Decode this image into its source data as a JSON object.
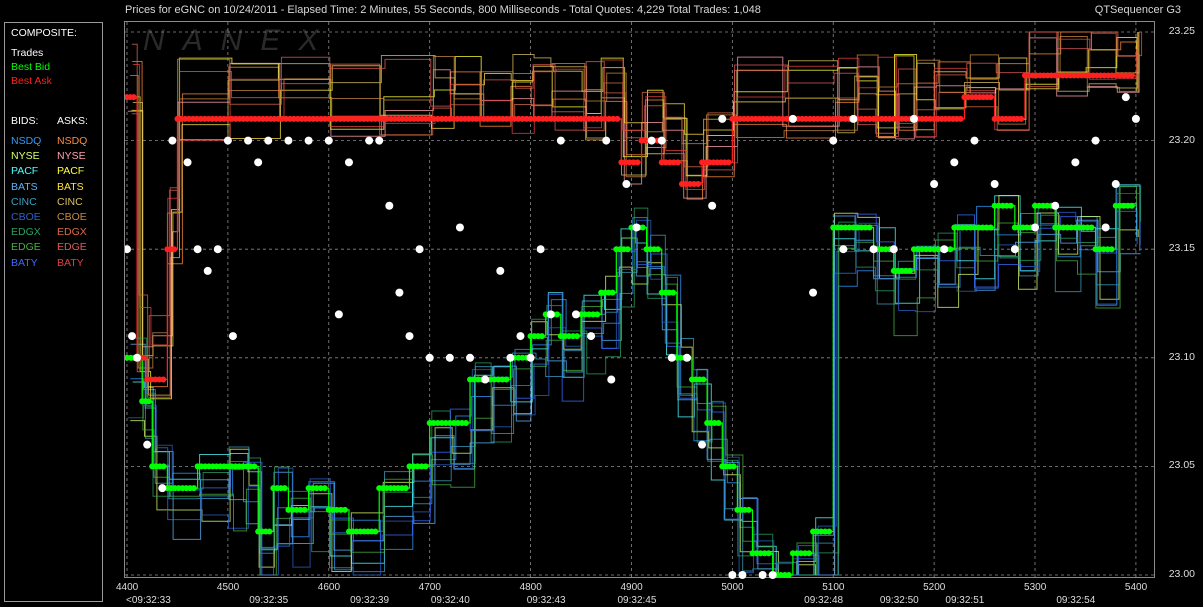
{
  "header": {
    "title": "Prices for  eGNC  on  10/24/2011  -  Elapsed Time: 2 Minutes, 55 Seconds, 800 Milliseconds  -  Total Quotes: 4,229  Total Trades: 1,048",
    "app_name": "QTSequencer G3",
    "watermark": "NANEX"
  },
  "legend": {
    "composite_label": "COMPOSITE:",
    "trades": "Trades",
    "best_bid": "Best Bid",
    "best_ask": "Best Ask",
    "bids_label": "BIDS:",
    "asks_label": "ASKS:",
    "exchanges": [
      {
        "bid": "NSDQ",
        "ask": "NSDQ",
        "bid_color": "#2f9bff",
        "ask_color": "#ff8a3a"
      },
      {
        "bid": "NYSE",
        "ask": "NYSE",
        "bid_color": "#d8ff6a",
        "ask_color": "#ff9fb0"
      },
      {
        "bid": "PACF",
        "ask": "PACF",
        "bid_color": "#4dffff",
        "ask_color": "#ffff33"
      },
      {
        "bid": "BATS",
        "ask": "BATS",
        "bid_color": "#5ab4ff",
        "ask_color": "#ffe040"
      },
      {
        "bid": "CINC",
        "ask": "CINC",
        "bid_color": "#3aa0c0",
        "ask_color": "#d8c060"
      },
      {
        "bid": "CBOE",
        "ask": "CBOE",
        "bid_color": "#2a60c8",
        "ask_color": "#c88840"
      },
      {
        "bid": "EDGX",
        "ask": "EDGX",
        "bid_color": "#2aa060",
        "ask_color": "#d86a4a"
      },
      {
        "bid": "EDGE",
        "ask": "EDGE",
        "bid_color": "#4ab040",
        "ask_color": "#e05a5a"
      },
      {
        "bid": "BATY",
        "ask": "BATY",
        "bid_color": "#3a6aff",
        "ask_color": "#e04040"
      }
    ],
    "colors": {
      "trades": "#ffffff",
      "best_bid": "#00ff00",
      "best_ask": "#ff2020"
    }
  },
  "chart_data": {
    "type": "line",
    "y_ticks": [
      "23.25",
      "23.20",
      "23.15",
      "23.10",
      "23.05",
      "23.00"
    ],
    "ylim": [
      23.0,
      23.25
    ],
    "x_seq_ticks": [
      "4400",
      "4500",
      "4600",
      "4700",
      "4800",
      "4900",
      "5000",
      "5100",
      "5200",
      "5300",
      "5400"
    ],
    "x_time_ticks": [
      "<09:32:33",
      "09:32:35",
      "09:32:39",
      "09:32:40",
      "09:32:43",
      "09:32:45",
      "09:32:48",
      "09:32:50",
      "09:32:51",
      "09:32:54"
    ],
    "xlim": [
      4400,
      5410
    ],
    "best_bid": [
      [
        4400,
        23.1
      ],
      [
        4415,
        23.08
      ],
      [
        4425,
        23.05
      ],
      [
        4440,
        23.04
      ],
      [
        4470,
        23.05
      ],
      [
        4500,
        23.05
      ],
      [
        4515,
        23.05
      ],
      [
        4530,
        23.02
      ],
      [
        4545,
        23.04
      ],
      [
        4560,
        23.03
      ],
      [
        4580,
        23.04
      ],
      [
        4600,
        23.03
      ],
      [
        4620,
        23.02
      ],
      [
        4650,
        23.04
      ],
      [
        4680,
        23.05
      ],
      [
        4700,
        23.07
      ],
      [
        4720,
        23.07
      ],
      [
        4740,
        23.09
      ],
      [
        4760,
        23.09
      ],
      [
        4780,
        23.1
      ],
      [
        4800,
        23.11
      ],
      [
        4815,
        23.12
      ],
      [
        4830,
        23.11
      ],
      [
        4850,
        23.12
      ],
      [
        4870,
        23.13
      ],
      [
        4885,
        23.15
      ],
      [
        4900,
        23.16
      ],
      [
        4915,
        23.15
      ],
      [
        4930,
        23.13
      ],
      [
        4945,
        23.1
      ],
      [
        4960,
        23.09
      ],
      [
        4975,
        23.07
      ],
      [
        4990,
        23.05
      ],
      [
        5005,
        23.03
      ],
      [
        5020,
        23.01
      ],
      [
        5040,
        23.0
      ],
      [
        5060,
        23.01
      ],
      [
        5080,
        23.02
      ],
      [
        5100,
        23.16
      ],
      [
        5120,
        23.16
      ],
      [
        5140,
        23.15
      ],
      [
        5160,
        23.14
      ],
      [
        5180,
        23.15
      ],
      [
        5200,
        23.15
      ],
      [
        5220,
        23.16
      ],
      [
        5240,
        23.16
      ],
      [
        5260,
        23.17
      ],
      [
        5280,
        23.16
      ],
      [
        5300,
        23.17
      ],
      [
        5320,
        23.16
      ],
      [
        5340,
        23.16
      ],
      [
        5360,
        23.15
      ],
      [
        5380,
        23.17
      ],
      [
        5400,
        23.17
      ]
    ],
    "best_ask": [
      [
        4400,
        23.22
      ],
      [
        4410,
        23.1
      ],
      [
        4420,
        23.09
      ],
      [
        4440,
        23.15
      ],
      [
        4450,
        23.21
      ],
      [
        4500,
        23.21
      ],
      [
        4550,
        23.21
      ],
      [
        4600,
        23.21
      ],
      [
        4650,
        23.21
      ],
      [
        4700,
        23.21
      ],
      [
        4720,
        23.21
      ],
      [
        4750,
        23.21
      ],
      [
        4780,
        23.21
      ],
      [
        4800,
        23.21
      ],
      [
        4820,
        23.21
      ],
      [
        4850,
        23.21
      ],
      [
        4870,
        23.21
      ],
      [
        4890,
        23.19
      ],
      [
        4910,
        23.2
      ],
      [
        4930,
        23.19
      ],
      [
        4950,
        23.18
      ],
      [
        4970,
        23.19
      ],
      [
        5000,
        23.21
      ],
      [
        5050,
        23.21
      ],
      [
        5100,
        23.21
      ],
      [
        5120,
        23.21
      ],
      [
        5140,
        23.21
      ],
      [
        5160,
        23.21
      ],
      [
        5180,
        23.21
      ],
      [
        5200,
        23.21
      ],
      [
        5230,
        23.22
      ],
      [
        5260,
        23.21
      ],
      [
        5290,
        23.23
      ],
      [
        5320,
        23.23
      ],
      [
        5350,
        23.23
      ],
      [
        5380,
        23.23
      ],
      [
        5400,
        23.23
      ]
    ],
    "trades": [
      [
        4400,
        23.15
      ],
      [
        4405,
        23.11
      ],
      [
        4410,
        23.1
      ],
      [
        4420,
        23.06
      ],
      [
        4435,
        23.04
      ],
      [
        4445,
        23.2
      ],
      [
        4460,
        23.19
      ],
      [
        4470,
        23.15
      ],
      [
        4480,
        23.14
      ],
      [
        4490,
        23.15
      ],
      [
        4500,
        23.2
      ],
      [
        4505,
        23.11
      ],
      [
        4520,
        23.2
      ],
      [
        4530,
        23.19
      ],
      [
        4540,
        23.2
      ],
      [
        4560,
        23.2
      ],
      [
        4580,
        23.2
      ],
      [
        4600,
        23.2
      ],
      [
        4610,
        23.12
      ],
      [
        4620,
        23.19
      ],
      [
        4640,
        23.2
      ],
      [
        4650,
        23.2
      ],
      [
        4660,
        23.17
      ],
      [
        4670,
        23.13
      ],
      [
        4680,
        23.11
      ],
      [
        4690,
        23.15
      ],
      [
        4700,
        23.1
      ],
      [
        4720,
        23.1
      ],
      [
        4730,
        23.16
      ],
      [
        4740,
        23.1
      ],
      [
        4755,
        23.09
      ],
      [
        4770,
        23.14
      ],
      [
        4780,
        23.1
      ],
      [
        4790,
        23.11
      ],
      [
        4800,
        23.1
      ],
      [
        4810,
        23.15
      ],
      [
        4820,
        23.12
      ],
      [
        4830,
        23.2
      ],
      [
        4845,
        23.12
      ],
      [
        4860,
        23.11
      ],
      [
        4875,
        23.2
      ],
      [
        4880,
        23.09
      ],
      [
        4895,
        23.18
      ],
      [
        4905,
        23.16
      ],
      [
        4920,
        23.2
      ],
      [
        4930,
        23.2
      ],
      [
        4940,
        23.1
      ],
      [
        4955,
        23.1
      ],
      [
        4970,
        23.06
      ],
      [
        4980,
        23.17
      ],
      [
        4990,
        23.21
      ],
      [
        5000,
        23.0
      ],
      [
        5010,
        23.0
      ],
      [
        5030,
        23.0
      ],
      [
        5040,
        23.0
      ],
      [
        5060,
        23.21
      ],
      [
        5080,
        23.13
      ],
      [
        5100,
        23.2
      ],
      [
        5110,
        23.15
      ],
      [
        5120,
        23.21
      ],
      [
        5140,
        23.15
      ],
      [
        5160,
        23.15
      ],
      [
        5180,
        23.21
      ],
      [
        5200,
        23.18
      ],
      [
        5210,
        23.15
      ],
      [
        5220,
        23.19
      ],
      [
        5240,
        23.2
      ],
      [
        5260,
        23.18
      ],
      [
        5280,
        23.15
      ],
      [
        5300,
        23.16
      ],
      [
        5320,
        23.17
      ],
      [
        5340,
        23.19
      ],
      [
        5360,
        23.2
      ],
      [
        5370,
        23.16
      ],
      [
        5380,
        23.18
      ],
      [
        5390,
        23.22
      ],
      [
        5400,
        23.21
      ]
    ]
  }
}
